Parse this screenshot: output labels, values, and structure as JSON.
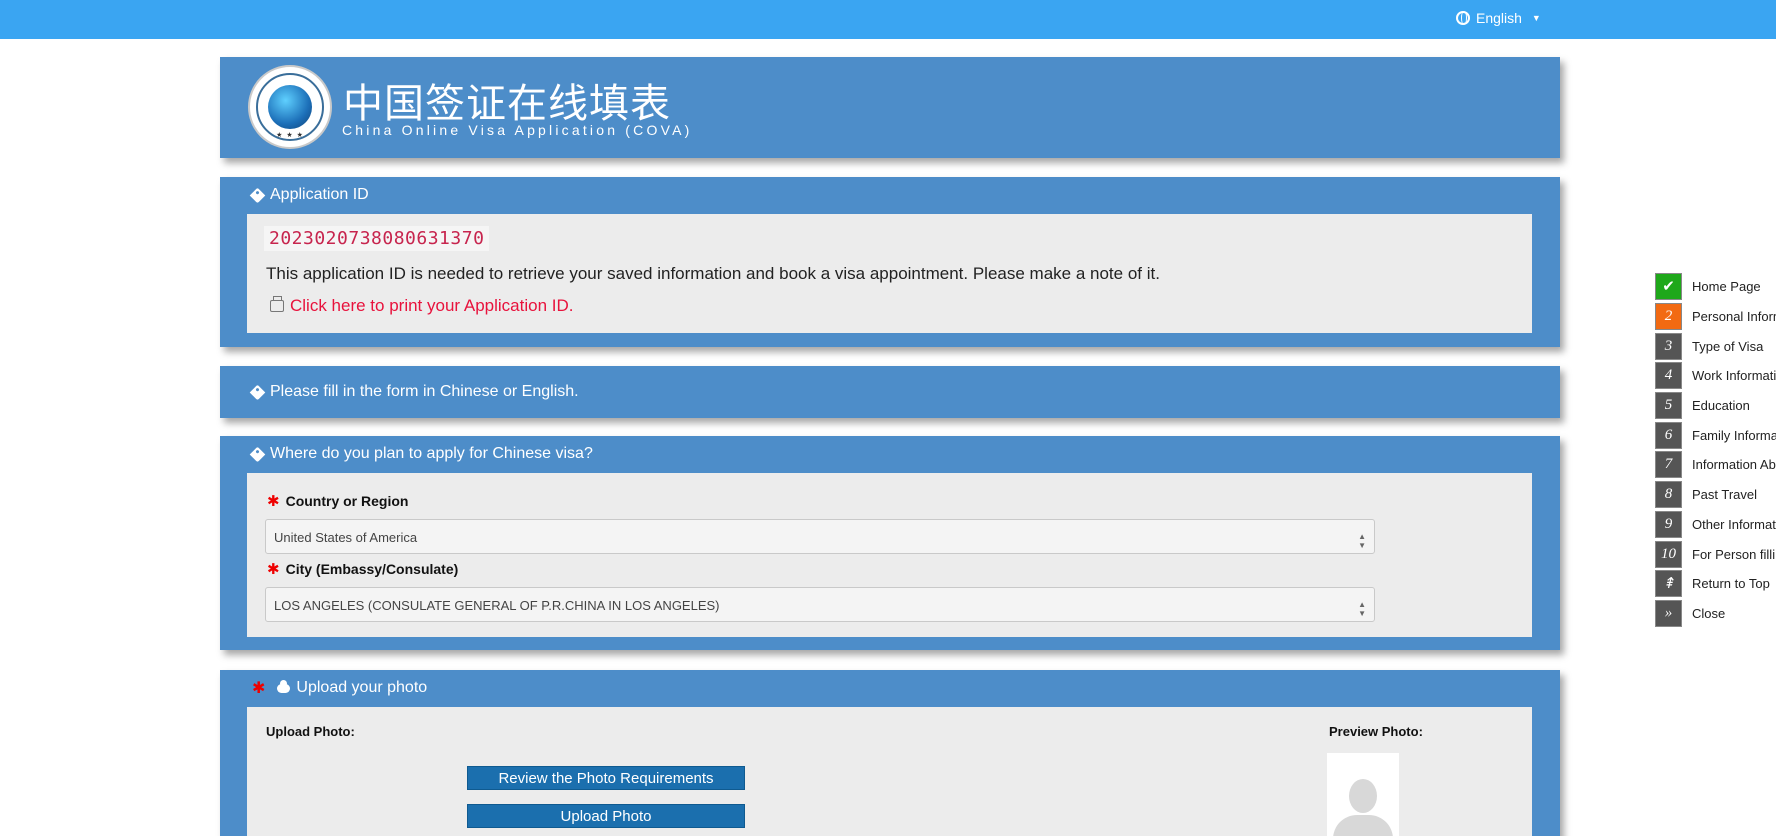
{
  "topbar": {
    "language": "English"
  },
  "header": {
    "title_cn": "中国签证在线填表",
    "title_en": "China Online Visa Application (COVA)"
  },
  "application": {
    "heading": "Application ID",
    "id": "2023020738080631370",
    "note": "This application ID is needed to retrieve your saved information and book a visa appointment. Please make a note of it.",
    "print_link": "Click here to print your Application ID."
  },
  "fill_notice": "Please fill in the form in Chinese or English.",
  "where": {
    "heading": "Where do you plan to apply for Chinese visa?",
    "country_label": "Country or Region",
    "country_value": "United States of America",
    "city_label": "City (Embassy/Consulate)",
    "city_value": "LOS ANGELES (CONSULATE GENERAL OF P.R.CHINA IN LOS ANGELES)"
  },
  "upload": {
    "heading": "Upload your photo",
    "upload_label": "Upload Photo:",
    "preview_label": "Preview Photo:",
    "review_button": "Review the Photo Requirements",
    "upload_button": "Upload Photo"
  },
  "steps": [
    {
      "num": "✔",
      "label": "Home Page",
      "state": "done"
    },
    {
      "num": "2",
      "label": "Personal Information",
      "state": "active"
    },
    {
      "num": "3",
      "label": "Type of Visa",
      "state": ""
    },
    {
      "num": "4",
      "label": "Work Information",
      "state": ""
    },
    {
      "num": "5",
      "label": "Education",
      "state": ""
    },
    {
      "num": "6",
      "label": "Family Information",
      "state": ""
    },
    {
      "num": "7",
      "label": "Information About",
      "state": ""
    },
    {
      "num": "8",
      "label": "Past Travel",
      "state": ""
    },
    {
      "num": "9",
      "label": "Other Information",
      "state": ""
    },
    {
      "num": "10",
      "label": "For Person filling",
      "state": ""
    },
    {
      "num": "⇞",
      "label": "Return to Top",
      "state": ""
    },
    {
      "num": "»",
      "label": "Close",
      "state": ""
    }
  ],
  "colors": {
    "topbar": "#3aa5f2",
    "panel": "#4d8dc9",
    "step_done": "#1fa81a",
    "step_active": "#f26a12",
    "link": "#e8123c"
  }
}
